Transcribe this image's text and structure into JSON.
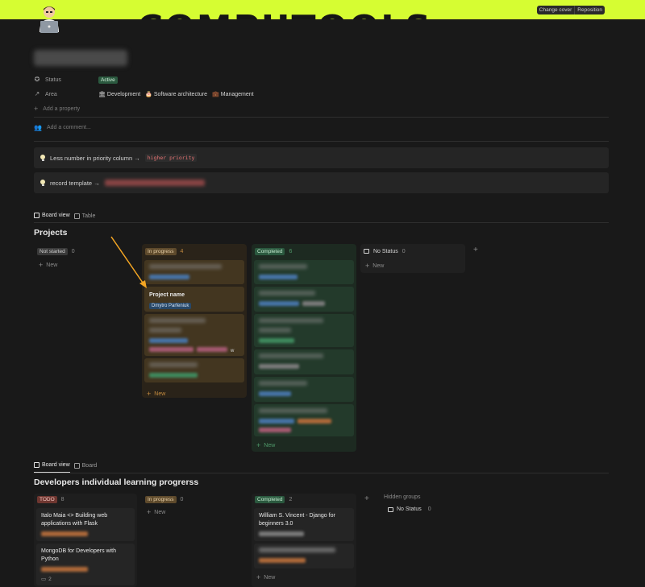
{
  "cover": {
    "title": "COMPUTOOLS",
    "buttons": [
      "Change cover",
      "Reposition"
    ],
    "color": "#d6fd32"
  },
  "page": {
    "properties": {
      "status_label": "Status",
      "status_value": "Active",
      "area_label": "Area",
      "areas": [
        "Development",
        "Software architecture",
        "Management"
      ],
      "add_property": "Add a property"
    },
    "comment_placeholder": "Add a comment...",
    "callouts": [
      {
        "text": "Less number in priority column →",
        "code": "higher priority"
      },
      {
        "text": "record template →"
      }
    ]
  },
  "board1": {
    "tabs": [
      "Board view",
      "Table"
    ],
    "title": "Projects",
    "columns": [
      {
        "name": "Not started",
        "count": "0"
      },
      {
        "name": "In progress",
        "count": "4"
      },
      {
        "name": "Completed",
        "count": "6"
      },
      {
        "name": "No Status",
        "count": "0"
      }
    ],
    "new_label": "New",
    "card": {
      "title": "Project name",
      "person": "Dmytro Parfeniuk",
      "extra": "w"
    }
  },
  "board2": {
    "tabs": [
      "Board view",
      "Board"
    ],
    "title": "Developers individual learning progrerss",
    "columns": [
      {
        "name": "TODO",
        "count": "8"
      },
      {
        "name": "In progress",
        "count": "0"
      },
      {
        "name": "Completed",
        "count": "2"
      }
    ],
    "cards": {
      "todo1": "Italo Maia <> Building web applications with Flask",
      "todo2": "MongoDB for Developers with Python",
      "todo2_comments": "2",
      "done1": "William S. Vincent - Django for beginners 3.0"
    },
    "hidden_groups": "Hidden groups",
    "hidden_no_status": "No Status",
    "hidden_count": "0",
    "new_label": "New"
  }
}
